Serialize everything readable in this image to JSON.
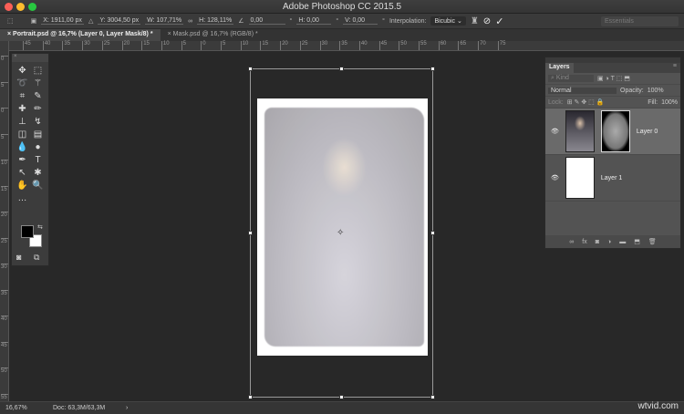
{
  "app": {
    "title": "Adobe Photoshop CC 2015.5",
    "workspace": "Essentials"
  },
  "options": {
    "x": "X: 1911,00 px",
    "y": "Y: 3004,50 px",
    "w": "W: 107,71%",
    "h": "H: 128,11%",
    "angle": "0,00",
    "hskew": "H: 0,00",
    "vskew": "V: 0,00",
    "deg": "°",
    "interp_label": "Interpolation:",
    "interp": "Bicubic"
  },
  "tabs": [
    {
      "label": "Portrait.psd @ 16,7% (Layer 0, Layer Mask/8) *"
    },
    {
      "label": "Mask.psd @ 16,7% (RGB/8) *"
    }
  ],
  "hruler": [
    "45",
    "40",
    "35",
    "30",
    "25",
    "20",
    "15",
    "10",
    "5",
    "0",
    "5",
    "10",
    "15",
    "20",
    "25",
    "30",
    "35",
    "40",
    "45",
    "50",
    "55",
    "60",
    "65",
    "70",
    "75"
  ],
  "vruler": [
    "0",
    "5",
    "0",
    "5",
    "10",
    "15",
    "20",
    "25",
    "30",
    "35",
    "40",
    "45",
    "50",
    "55"
  ],
  "layers_panel": {
    "title": "Layers",
    "kind": "Kind",
    "blend": "Normal",
    "opacity_label": "Opacity:",
    "opacity": "100%",
    "lock_label": "Lock:",
    "fill_label": "Fill:",
    "fill": "100%",
    "layers": [
      {
        "name": "Layer 0"
      },
      {
        "name": "Layer 1"
      }
    ]
  },
  "status": {
    "zoom": "16,67%",
    "doc": "Doc: 63,3M/63,3M"
  },
  "watermark": "wtvid.com"
}
